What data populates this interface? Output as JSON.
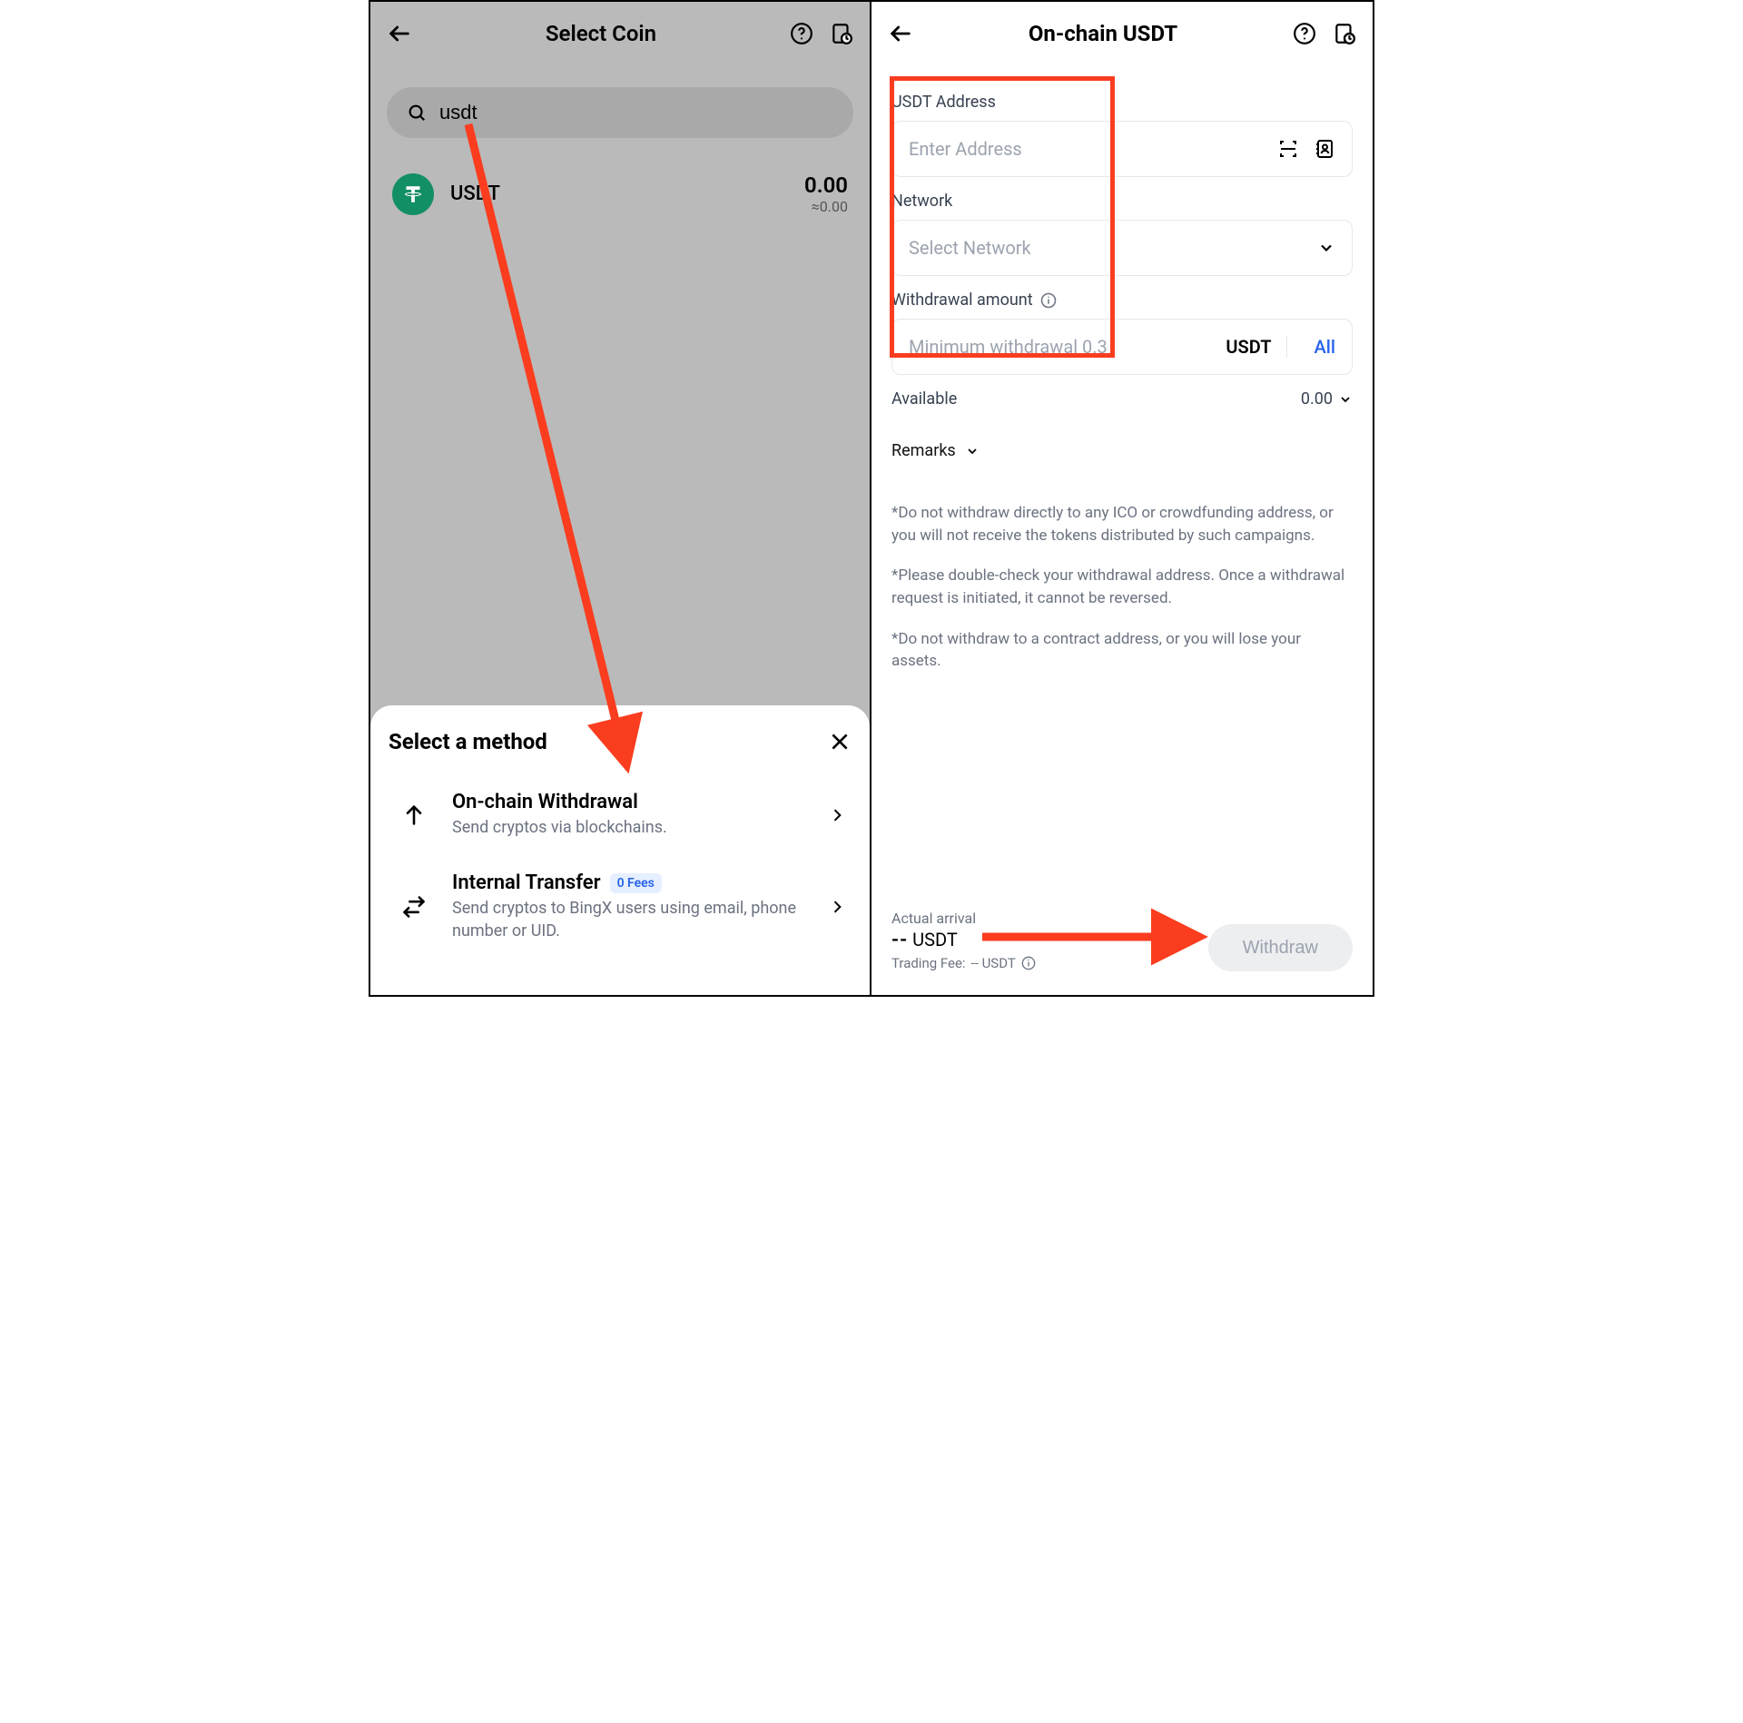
{
  "left": {
    "header_title": "Select Coin",
    "search_value": "usdt",
    "coin": {
      "symbol": "USDT",
      "balance": "0.00",
      "sub": "≈0.00"
    },
    "sheet": {
      "title": "Select a method",
      "methods": [
        {
          "name": "On-chain Withdrawal",
          "desc": "Send cryptos via blockchains."
        },
        {
          "name": "Internal Transfer",
          "badge": "0 Fees",
          "desc": "Send cryptos to BingX users using email, phone number or UID."
        }
      ]
    }
  },
  "right": {
    "header_title": "On-chain USDT",
    "labels": {
      "address": "USDT Address",
      "network": "Network",
      "amount": "Withdrawal amount",
      "available": "Available",
      "remarks": "Remarks"
    },
    "placeholders": {
      "address": "Enter Address",
      "network": "Select Network",
      "amount": "Minimum withdrawal 0.3"
    },
    "unit": "USDT",
    "all": "All",
    "available_value": "0.00",
    "notes": [
      "*Do not withdraw directly to any ICO or crowdfunding address, or you will not receive the tokens distributed by such campaigns.",
      "*Please double-check your withdrawal address. Once a withdrawal request is initiated, it cannot be reversed.",
      "*Do not withdraw to a contract address, or you will lose your assets."
    ],
    "footer": {
      "actual_arrival_label": "Actual arrival",
      "actual_arrival_value_prefix": "--",
      "actual_arrival_unit": "USDT",
      "fee_label": "Trading Fee:",
      "fee_value": "-- USDT",
      "withdraw": "Withdraw"
    }
  }
}
